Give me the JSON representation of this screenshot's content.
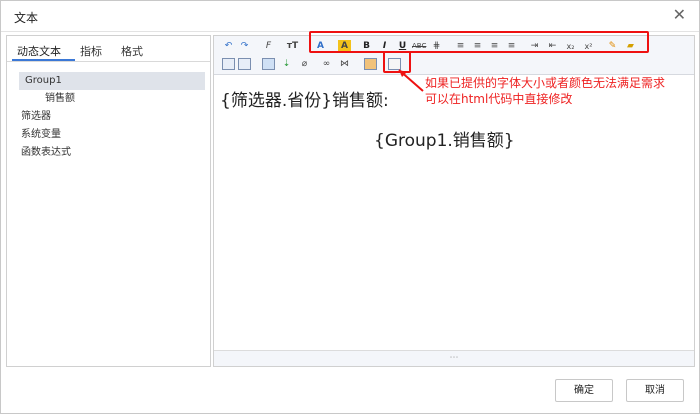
{
  "dialog": {
    "title": "文本"
  },
  "tabs": [
    {
      "label": "动态文本"
    },
    {
      "label": "指标"
    },
    {
      "label": "格式"
    }
  ],
  "tree": [
    {
      "label": "Group1"
    },
    {
      "label": "销售额"
    },
    {
      "label": "筛选器"
    },
    {
      "label": "系统变量"
    },
    {
      "label": "函数表达式"
    }
  ],
  "editor": {
    "line1": "{筛选器.省份}销售额:",
    "line2": "{Group1.销售额}"
  },
  "note": {
    "line1": "如果已提供的字体大小或者颜色无法满足需求",
    "line2": "可以在html代码中直接修改"
  },
  "buttons": {
    "ok": "确定",
    "cancel": "取消"
  },
  "colors": {
    "accent": "#3b78d6",
    "annotation": "#ee1111"
  },
  "icons": [
    "undo-icon",
    "redo-icon",
    "font-family-icon",
    "font-size-icon",
    "font-color-icon",
    "highlight-icon",
    "bold-icon",
    "italic-icon",
    "underline-icon",
    "strikethrough-icon",
    "table-icon",
    "align-left-icon",
    "align-center-icon",
    "align-right-icon",
    "justify-icon",
    "indent-icon",
    "outdent-icon",
    "subscript-icon",
    "superscript-icon",
    "brush-icon",
    "eraser-icon",
    "paste-icon",
    "paste-text-icon",
    "grid-icon",
    "insert-icon",
    "clear-format-icon",
    "link-icon",
    "unlink-icon",
    "image-icon",
    "source-code-icon"
  ]
}
